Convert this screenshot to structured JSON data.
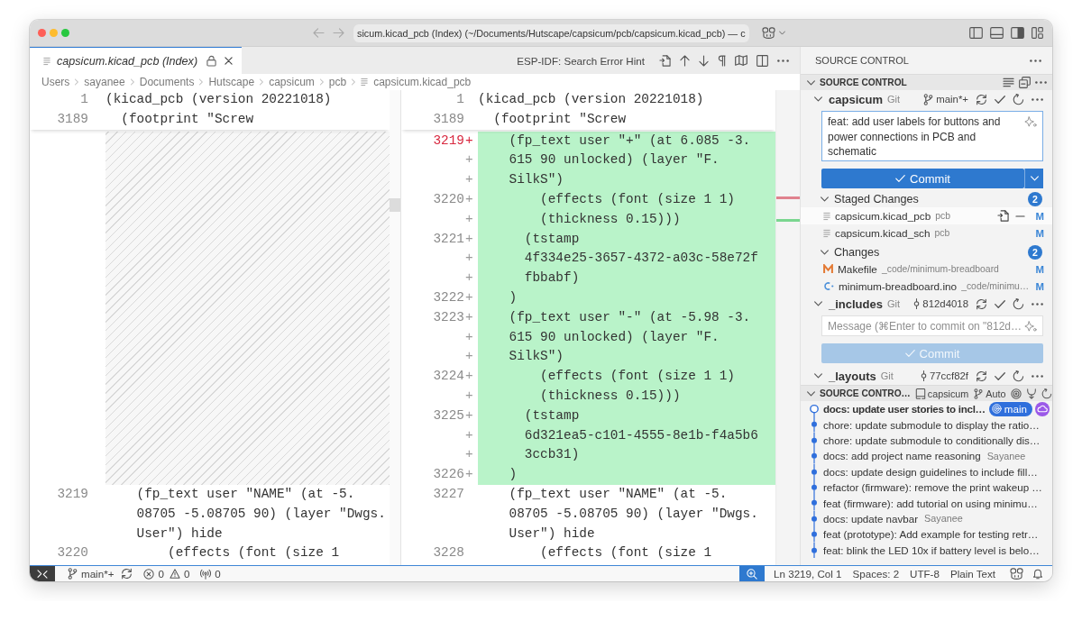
{
  "window": {
    "title": "sicum.kicad_pcb (Index) (~/Documents/Hutscape/capsicum/pcb/capsicum.kicad_pcb) — c"
  },
  "editor": {
    "tabs": [
      {
        "label": "capsicum.kicad_pcb (Index)",
        "selected": true
      }
    ],
    "toolbar": {
      "hint": "ESP-IDF: Search Error Hint"
    },
    "breadcrumb": [
      "Users",
      "sayanee",
      "Documents",
      "Hutscape",
      "capsicum",
      "pcb",
      "capsicum.kicad_pcb"
    ],
    "diff": {
      "original": {
        "sticky_lines": [
          {
            "number": "1",
            "text": "(kicad_pcb (version 20221018)"
          },
          {
            "number": "3189",
            "text": "  (footprint \"Screw"
          }
        ],
        "lines": [
          {
            "kind": "filler"
          },
          {
            "kind": "code",
            "number": "3219",
            "text": "    (fp_text user \"NAME\" (at -5."
          },
          {
            "kind": "code",
            "text": "    08705 -5.08705 90) (layer \"Dwgs."
          },
          {
            "kind": "code",
            "text": "    User\") hide"
          },
          {
            "kind": "code",
            "number": "3220",
            "text": "        (effects (font (size 1"
          }
        ]
      },
      "modified": {
        "sticky_lines": [
          {
            "number": "1",
            "text": "(kicad_pcb (version 20221018)"
          },
          {
            "number": "3189",
            "text": "  (footprint \"Screw"
          }
        ],
        "lines": [
          {
            "kind": "added",
            "number": "3219",
            "marker": "+",
            "current": true,
            "text": "    (fp_text user \"+\" (at 6.085 -3."
          },
          {
            "kind": "added",
            "marker": "+",
            "current": false,
            "text": "    615 90 unlocked) (layer \"F."
          },
          {
            "kind": "added",
            "marker": "+",
            "current": false,
            "text": "    SilkS\")"
          },
          {
            "kind": "added",
            "number": "3220",
            "marker": "+",
            "current": false,
            "text": "        (effects (font (size 1 1)"
          },
          {
            "kind": "added",
            "marker": "+",
            "current": false,
            "text": "        (thickness 0.15)))"
          },
          {
            "kind": "added",
            "number": "3221",
            "marker": "+",
            "current": false,
            "text": "      (tstamp"
          },
          {
            "kind": "added",
            "marker": "+",
            "current": false,
            "text": "      4f334e25-3657-4372-a03c-58e72f"
          },
          {
            "kind": "added",
            "marker": "+",
            "current": false,
            "text": "      fbbabf)"
          },
          {
            "kind": "added",
            "number": "3222",
            "marker": "+",
            "current": false,
            "text": "    )"
          },
          {
            "kind": "added",
            "number": "3223",
            "marker": "+",
            "current": false,
            "text": "    (fp_text user \"-\" (at -5.98 -3."
          },
          {
            "kind": "added",
            "marker": "+",
            "current": false,
            "text": "    615 90 unlocked) (layer \"F."
          },
          {
            "kind": "added",
            "marker": "+",
            "current": false,
            "text": "    SilkS\")"
          },
          {
            "kind": "added",
            "number": "3224",
            "marker": "+",
            "current": false,
            "text": "        (effects (font (size 1 1)"
          },
          {
            "kind": "added",
            "marker": "+",
            "current": false,
            "text": "        (thickness 0.15)))"
          },
          {
            "kind": "added",
            "number": "3225",
            "marker": "+",
            "current": false,
            "text": "      (tstamp"
          },
          {
            "kind": "added",
            "marker": "+",
            "current": false,
            "text": "      6d321ea5-c101-4555-8e1b-f4a5b6"
          },
          {
            "kind": "added",
            "marker": "+",
            "current": false,
            "text": "      3ccb31)"
          },
          {
            "kind": "added",
            "number": "3226",
            "marker": "+",
            "current": false,
            "text": "    )"
          },
          {
            "kind": "code",
            "number": "3227",
            "current": false,
            "text": "    (fp_text user \"NAME\" (at -5."
          },
          {
            "kind": "code",
            "current": false,
            "text": "    08705 -5.08705 90) (layer \"Dwgs."
          },
          {
            "kind": "code",
            "current": false,
            "text": "    User\") hide"
          },
          {
            "kind": "code",
            "number": "3228",
            "current": false,
            "text": "        (effects (font (size 1"
          }
        ]
      }
    }
  },
  "sidebar": {
    "title": "SOURCE CONTROL",
    "sections": [
      {
        "kind": "repositories",
        "title": "SOURCE CONTROL",
        "expanded": true,
        "repos": [
          {
            "name": "capsicum",
            "provider": "Git",
            "ref": {
              "kind": "branch",
              "label": "main*+"
            },
            "expanded": true,
            "message": {
              "value": "feat: add user labels for buttons and power connections in PCB and schematic"
            },
            "commit": {
              "label": "Commit",
              "disabled": false,
              "dropdown": true
            },
            "groups": [
              {
                "label": "Staged Changes",
                "count": "2",
                "expanded": true,
                "files": [
                  {
                    "kind": "text",
                    "name": "capsicum.kicad_pcb",
                    "path": "pcb",
                    "status": "M",
                    "selected": true
                  },
                  {
                    "kind": "text",
                    "name": "capsicum.kicad_sch",
                    "path": "pcb",
                    "status": "M",
                    "selected": false
                  }
                ]
              },
              {
                "label": "Changes",
                "count": "2",
                "expanded": true,
                "files": [
                  {
                    "kind": "makefile",
                    "name": "Makefile",
                    "path": "_code/minimum-breadboard",
                    "status": "M",
                    "selected": false
                  },
                  {
                    "kind": "c",
                    "name": "minimum-breadboard.ino",
                    "path": "_code/minimu…",
                    "status": "M",
                    "selected": false
                  }
                ]
              }
            ]
          },
          {
            "name": "_includes",
            "provider": "Git",
            "ref": {
              "kind": "commit",
              "label": "812d4018"
            },
            "expanded": true,
            "message": {
              "placeholder": "Message (⌘Enter to commit on \"812d…"
            },
            "commit": {
              "label": "Commit",
              "disabled": true,
              "dropdown": false
            }
          },
          {
            "name": "_layouts",
            "provider": "Git",
            "ref": {
              "kind": "commit",
              "label": "77ccf82f"
            },
            "expanded": true
          }
        ]
      },
      {
        "kind": "graph",
        "title": "SOURCE CONTRO…",
        "expanded": true,
        "repo": "capsicum",
        "branch": "Auto",
        "commits": [
          {
            "message": "docs: update user stories to incl…",
            "head": true,
            "remote": true,
            "refs": [
              {
                "label": "main"
              }
            ]
          },
          {
            "message": "chore: update submodule to display the ratio…",
            "head": false,
            "remote": false
          },
          {
            "message": "chore: update submodule to conditionally dis…",
            "head": false,
            "remote": false
          },
          {
            "message": "docs: add project name reasoning",
            "author": "Sayanee",
            "head": false,
            "remote": false
          },
          {
            "message": "docs: update design guidelines to include fill…",
            "head": false,
            "remote": false
          },
          {
            "message": "refactor (firmware): remove the print wakeup …",
            "head": false,
            "remote": false
          },
          {
            "message": "feat (firmware): add tutorial on using minimu…",
            "head": false,
            "remote": false
          },
          {
            "message": "docs: update navbar",
            "author": "Sayanee",
            "head": false,
            "remote": false
          },
          {
            "message": "feat (prototype): Add example for testing retr…",
            "head": false,
            "remote": false
          },
          {
            "message": "feat: blink the LED 10x if battery level is belo…",
            "head": false,
            "remote": false
          }
        ]
      }
    ]
  },
  "status_bar": {
    "branch": "main*+",
    "errors": "0",
    "warnings": "0",
    "ports": "0",
    "position": "Ln 3219, Col 1",
    "indentation": "Spaces: 2",
    "encoding": "UTF-8",
    "language": "Plain Text"
  }
}
